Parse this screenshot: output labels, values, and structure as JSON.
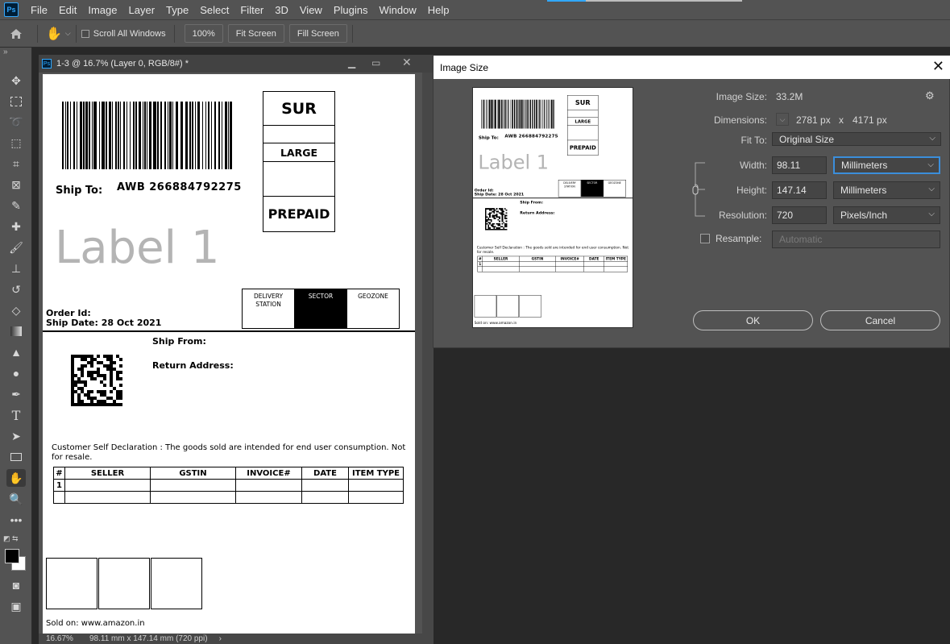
{
  "menubar": {
    "logo": "Ps",
    "items": [
      "File",
      "Edit",
      "Image",
      "Layer",
      "Type",
      "Select",
      "Filter",
      "3D",
      "View",
      "Plugins",
      "Window",
      "Help"
    ]
  },
  "options": {
    "scroll_all_label": "Scroll All Windows",
    "zoom_label": "100%",
    "fit_screen_label": "Fit Screen",
    "fill_screen_label": "Fill Screen"
  },
  "document": {
    "tab_title": "1-3 @ 16.7% (Layer 0, RGB/8#) *",
    "status_zoom": "16.67%",
    "status_info": "98.11 mm x 147.14 mm (720 ppi)"
  },
  "label": {
    "ship_to": "Ship To:",
    "awb": "AWB 266884792275",
    "box_sur": "SUR",
    "box_large": "LARGE",
    "box_prepaid": "PREPAID",
    "watermark": "Label 1",
    "sector_headers": [
      "DELIVERY STATION",
      "SECTOR",
      "GEOZONE"
    ],
    "order_id": "Order Id:",
    "ship_date": "Ship Date: 28 Oct 2021",
    "ship_from": "Ship From:",
    "return_address": "Return Address:",
    "declaration": "Customer Self Declaration : The goods sold are intended for end user consumption. Not",
    "declaration2": "for resale.",
    "table_headers": [
      "#",
      "SELLER",
      "GSTIN",
      "INVOICE#",
      "DATE",
      "ITEM TYPE"
    ],
    "table_row1": [
      "1",
      "",
      "",
      "",
      "",
      ""
    ],
    "sold_on": "Sold on: www.amazon.in"
  },
  "dialog": {
    "title": "Image Size",
    "image_size_label": "Image Size:",
    "image_size_value": "33.2M",
    "dimensions_label": "Dimensions:",
    "dimensions_w": "2781 px",
    "dimensions_x": "x",
    "dimensions_h": "4171 px",
    "fit_to_label": "Fit To:",
    "fit_to_value": "Original Size",
    "width_label": "Width:",
    "width_value": "98.11",
    "width_unit": "Millimeters",
    "height_label": "Height:",
    "height_value": "147.14",
    "height_unit": "Millimeters",
    "resolution_label": "Resolution:",
    "resolution_value": "720",
    "resolution_unit": "Pixels/Inch",
    "resample_label": "Resample:",
    "resample_value": "Automatic",
    "ok_label": "OK",
    "cancel_label": "Cancel"
  },
  "colors": {
    "accent": "#31a8ff",
    "focus": "#3b8edb",
    "panel": "#535353",
    "background": "#282828"
  }
}
